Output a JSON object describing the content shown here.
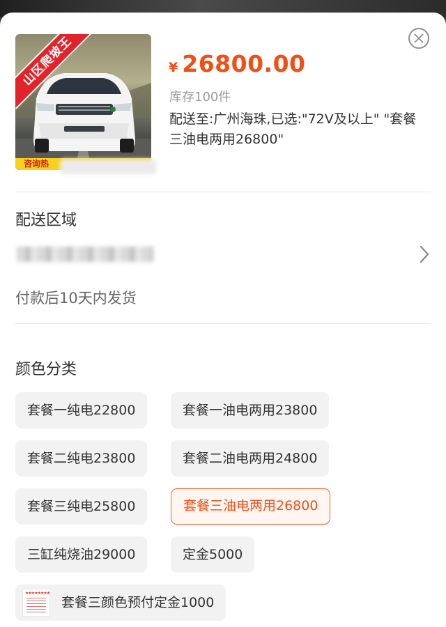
{
  "product": {
    "ribbon_text": "山区爬坡王",
    "yellow_bar_text": "咨询热",
    "currency": "¥",
    "price": "26800.00",
    "stock": "库存100件",
    "selected_info": "配送至:广州海珠,已选:\"72V及以上\" \"套餐三油电两用26800\""
  },
  "delivery": {
    "title": "配送区域",
    "ship_note": "付款后10天内发货"
  },
  "colors": {
    "title": "颜色分类",
    "options": [
      "套餐一纯电22800",
      "套餐一油电两用23800",
      "套餐二纯电23800",
      "套餐二油电两用24800",
      "套餐三纯电25800",
      "套餐三油电两用26800",
      "三缸纯烧油29000",
      "定金5000",
      "套餐三颜色预付定金1000"
    ],
    "selected_index": 5
  },
  "theme": {
    "accent": "#f34e14",
    "option_bg": "#f2f2f2"
  },
  "icons": [
    "close-icon",
    "chevron-right-icon"
  ]
}
